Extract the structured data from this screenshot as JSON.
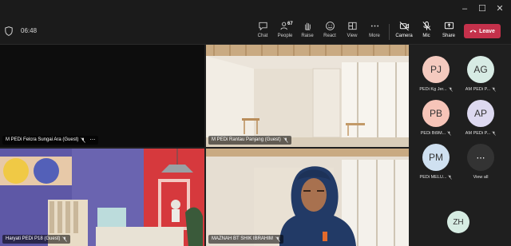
{
  "meeting": {
    "timer": "06:48"
  },
  "toolbar": {
    "chat": "Chat",
    "people": "People",
    "people_count": "67",
    "raise": "Raise",
    "react": "React",
    "view": "View",
    "more": "More",
    "camera": "Camera",
    "mic": "Mic",
    "share": "Share",
    "leave": "Leave"
  },
  "tiles": [
    {
      "name": "M PEDi Felcra Sungai Ara (Guest)"
    },
    {
      "name": "M PEDi Rantau Panjang (Guest)"
    },
    {
      "name": "Haryati PEDi P18 (Guest)"
    },
    {
      "name": "MAZNAH BT SHIK IBRAHIM"
    }
  ],
  "roster": {
    "people": [
      {
        "initials": "PJ",
        "name": "PEDi Kg Jer...",
        "color": "#f4cabf"
      },
      {
        "initials": "AG",
        "name": "AM PEDi P...",
        "color": "#d7ebe4"
      },
      {
        "initials": "PB",
        "name": "PEDi Bt9M...",
        "color": "#f6c4b8"
      },
      {
        "initials": "AP",
        "name": "AM PEDi P...",
        "color": "#ddd9f0"
      },
      {
        "initials": "PM",
        "name": "PEDi MELU...",
        "color": "#cfe0f0"
      },
      {
        "initials": "ZH",
        "name": "",
        "color": "#d6ece2"
      }
    ],
    "view_all": "View all"
  }
}
